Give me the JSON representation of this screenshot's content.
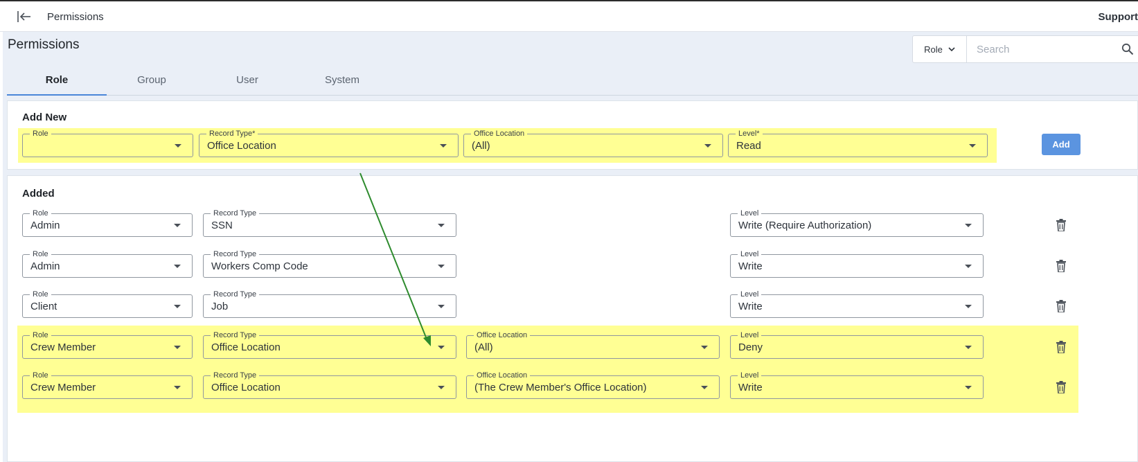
{
  "topbar": {
    "title": "Permissions",
    "support": "Support"
  },
  "page": {
    "title": "Permissions"
  },
  "search": {
    "filter": "Role",
    "placeholder": "Search"
  },
  "tabs": [
    "Role",
    "Group",
    "User",
    "System"
  ],
  "active_tab": "Role",
  "add_new": {
    "title": "Add New",
    "fields": [
      {
        "label": "Role",
        "value": ""
      },
      {
        "label": "Record Type*",
        "value": "Office Location"
      },
      {
        "label": "Office Location",
        "value": "(All)"
      },
      {
        "label": "Level*",
        "value": "Read"
      }
    ],
    "add_label": "Add"
  },
  "added": {
    "title": "Added",
    "rows": [
      {
        "role_label": "Role",
        "role": "Admin",
        "record_type_label": "Record Type",
        "record_type": "SSN",
        "level_label": "Level",
        "level": "Write (Require Authorization)"
      },
      {
        "role_label": "Role",
        "role": "Admin",
        "record_type_label": "Record Type",
        "record_type": "Workers Comp Code",
        "level_label": "Level",
        "level": "Write"
      },
      {
        "role_label": "Role",
        "role": "Client",
        "record_type_label": "Record Type",
        "record_type": "Job",
        "level_label": "Level",
        "level": "Write"
      },
      {
        "role_label": "Role",
        "role": "Crew Member",
        "record_type_label": "Record Type",
        "record_type": "Office Location",
        "office_location_label": "Office Location",
        "office_location": "(All)",
        "level_label": "Level",
        "level": "Deny"
      },
      {
        "role_label": "Role",
        "role": "Crew Member",
        "record_type_label": "Record Type",
        "record_type": "Office Location",
        "office_location_label": "Office Location",
        "office_location": "(The Crew Member's Office Location)",
        "level_label": "Level",
        "level": "Write"
      }
    ]
  },
  "colors": {
    "highlight": "#ffff94",
    "accent": "#4a86d8",
    "add_button": "#5b94e0",
    "annotation_arrow": "#2e8b2e"
  }
}
